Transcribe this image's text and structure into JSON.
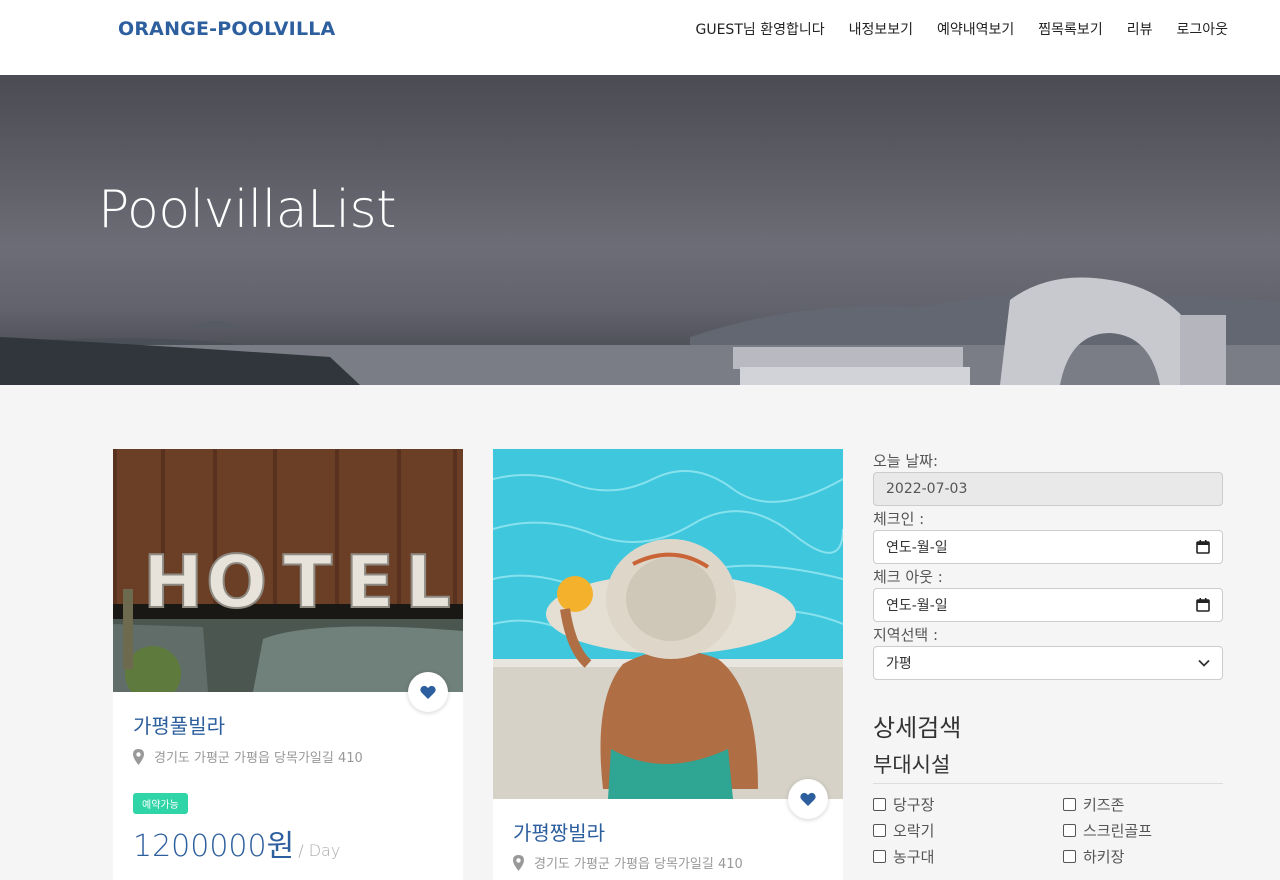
{
  "nav": {
    "brand": "ORANGE-POOLVILLA",
    "links": [
      "GUEST님 환영합니다",
      "내정보보기",
      "예약내역보기",
      "찜목록보기",
      "리뷰",
      "로그아웃"
    ]
  },
  "hero": {
    "title": "PoolvillaList"
  },
  "cards": [
    {
      "title": "가평풀빌라",
      "address": "경기도 가평군 가평읍 당목가일길 410",
      "badge": "예약가능",
      "price": "1200000원",
      "per": "/ Day"
    },
    {
      "title": "가평짱빌라",
      "address": "경기도 가평군 가평읍 당목가일길 410"
    }
  ],
  "search": {
    "today_label": "오늘 날짜:",
    "today_value": "2022-07-03",
    "checkin_label": "체크인 :",
    "checkin_value": "연도-월-일",
    "checkout_label": "체크 아웃 :",
    "checkout_value": "연도-월-일",
    "region_label": "지역선택 :",
    "region_value": "가평",
    "detail_title": "상세검색",
    "facilities_title": "부대시설",
    "facilities": [
      "당구장",
      "키즈존",
      "오락기",
      "스크린골프",
      "농구대",
      "하키장"
    ]
  },
  "colors": {
    "brand": "#2d5f9e",
    "badge": "#2fd4a7"
  }
}
